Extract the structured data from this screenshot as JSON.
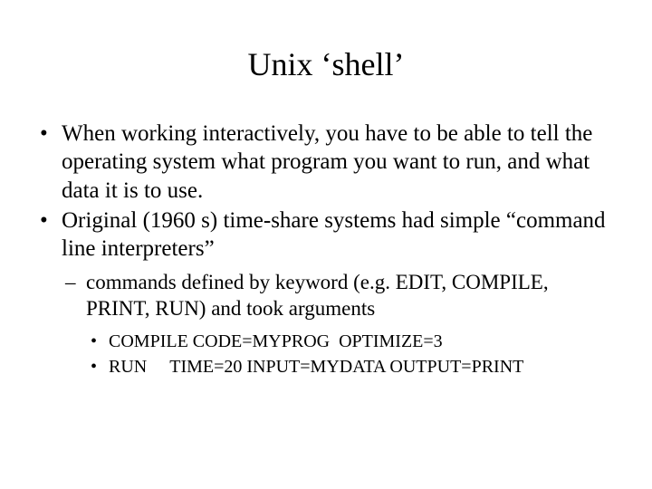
{
  "title": "Unix ‘shell’",
  "bullets": [
    "When working interactively, you have to be able to tell the operating system what program you want to run, and what data it is to use.",
    "Original (1960 s) time-share systems had simple “command line interpreters”"
  ],
  "sub_bullets": [
    "commands defined by keyword (e.g. EDIT, COMPILE, PRINT, RUN) and took arguments"
  ],
  "sub_sub_bullets": [
    "COMPILE CODE=MYPROG  OPTIMIZE=3",
    "RUN     TIME=20 INPUT=MYDATA OUTPUT=PRINT"
  ]
}
